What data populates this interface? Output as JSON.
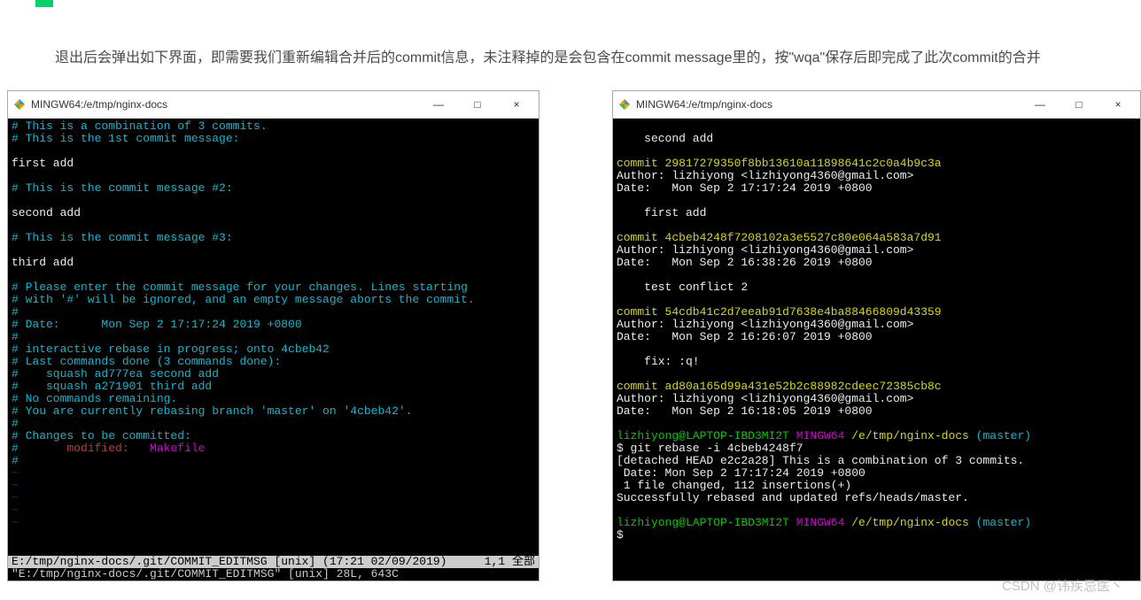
{
  "intro": "　　退出后会弹出如下界面，即需要我们重新编辑合并后的commit信息，未注释掉的是会包含在commit message里的，按\"wqa\"保存后即完成了此次commit的合并",
  "window_title": "MINGW64:/e/tmp/nginx-docs",
  "win_controls": {
    "min": "—",
    "max": "□",
    "close": "×"
  },
  "left": {
    "l1": "# This is a combination of 3 commits.",
    "l2": "# This is the 1st commit message:",
    "l3": "first add",
    "l4": "# This is the commit message #2:",
    "l5": "second add",
    "l6": "# This is the commit message #3:",
    "l7": "third add",
    "l8a": "# Please enter the commit message for your changes. Lines starting",
    "l8b": "# with '#' will be ignored, and an empty message aborts the commit.",
    "l8c": "#",
    "l9": "# Date:      Mon Sep 2 17:17:24 2019 +0800",
    "l10": "# interactive rebase in progress; onto 4cbeb42",
    "l11": "# Last commands done (3 commands done):",
    "l12": "#    squash ad777ea second add",
    "l13": "#    squash a271901 third add",
    "l14": "# No commands remaining.",
    "l15": "# You are currently rebasing branch 'master' on '4cbeb42'.",
    "l16": "# Changes to be committed:",
    "l17a": "#",
    "l17m": "       modified:   ",
    "l17f": "Makefile",
    "l18": "#",
    "tilde": "~",
    "status1_left": "E:/tmp/nginx-docs/.git/COMMIT_EDITMSG [unix] (17:21 02/09/2019)",
    "status1_right": "1,1 全部",
    "status2": "\"E:/tmp/nginx-docs/.git/COMMIT_EDITMSG\" [unix] 28L, 643C"
  },
  "right": {
    "r1": "    second add",
    "c1": "commit 29817279350f8bb13610a11898641c2c0a4b9c3a",
    "a1": "Author: lizhiyong <lizhiyong4360@gmail.com>",
    "d1": "Date:   Mon Sep 2 17:17:24 2019 +0800",
    "m1": "    first add",
    "c2": "commit 4cbeb4248f7208102a3e5527c80e064a583a7d91",
    "a2": "Author: lizhiyong <lizhiyong4360@gmail.com>",
    "d2": "Date:   Mon Sep 2 16:38:26 2019 +0800",
    "m2": "    test conflict 2",
    "c3": "commit 54cdb41c2d7eeab91d7638e4ba88466809d43359",
    "a3": "Author: lizhiyong <lizhiyong4360@gmail.com>",
    "d3": "Date:   Mon Sep 2 16:26:07 2019 +0800",
    "m3": "    fix: :q!",
    "c4": "commit ad80a165d99a431e52b2c88982cdeec72385cb8c",
    "a4": "Author: lizhiyong <lizhiyong4360@gmail.com>",
    "d4": "Date:   Mon Sep 2 16:18:05 2019 +0800",
    "p1a": "lizhiyong@LAPTOP-IBD3MI2T",
    "p1b": " MINGW64",
    "p1c": " /e/tmp/nginx-docs",
    "p1d": " (master)",
    "cmd1": "$ git rebase -i 4cbeb4248f7",
    "o1": "[detached HEAD e2c2a28] This is a combination of 3 commits.",
    "o2": " Date: Mon Sep 2 17:17:24 2019 +0800",
    "o3": " 1 file changed, 112 insertions(+)",
    "o4": "Successfully rebased and updated refs/heads/master.",
    "cmd2": "$"
  },
  "watermark": "CSDN @讳疾忌医丶"
}
